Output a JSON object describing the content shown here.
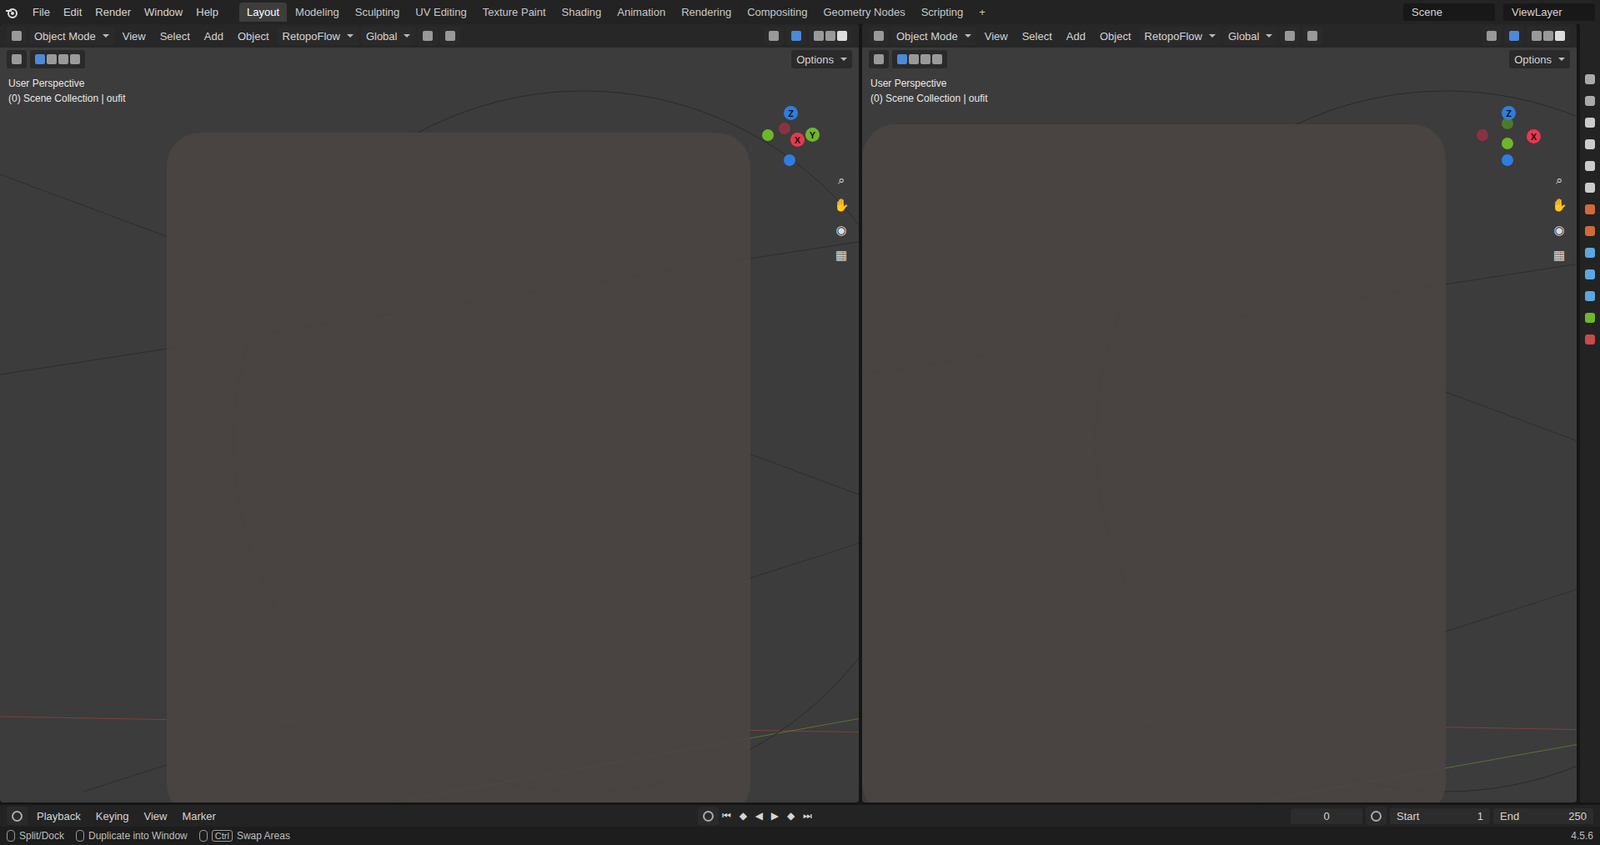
{
  "topbar": {
    "menus": [
      "File",
      "Edit",
      "Render",
      "Window",
      "Help"
    ],
    "workspaces": [
      {
        "label": "Layout",
        "selected": true
      },
      {
        "label": "Modeling",
        "selected": false
      },
      {
        "label": "Sculpting",
        "selected": false
      },
      {
        "label": "UV Editing",
        "selected": false
      },
      {
        "label": "Texture Paint",
        "selected": false
      },
      {
        "label": "Shading",
        "selected": false
      },
      {
        "label": "Animation",
        "selected": false
      },
      {
        "label": "Rendering",
        "selected": false
      },
      {
        "label": "Compositing",
        "selected": false
      },
      {
        "label": "Geometry Nodes",
        "selected": false
      },
      {
        "label": "Scripting",
        "selected": false
      }
    ],
    "add_tab": "+",
    "scene": "Scene",
    "view_layer": "ViewLayer"
  },
  "viewports": [
    {
      "mode": "Object Mode",
      "menus": [
        "View",
        "Select",
        "Add",
        "Object"
      ],
      "addon": "RetopoFlow",
      "orientation": "Global",
      "options": "Options",
      "view_name": "User Perspective",
      "collection": "(0) Scene Collection | oufit",
      "gizmo": [
        {
          "label": "Z",
          "color": "#2f7de1"
        },
        {
          "label": "Y",
          "color": "#6fb62a"
        },
        {
          "label": "X",
          "color": "#e8384f"
        }
      ]
    },
    {
      "mode": "Object Mode",
      "menus": [
        "View",
        "Select",
        "Add",
        "Object"
      ],
      "addon": "RetopoFlow",
      "orientation": "Global",
      "options": "Options",
      "view_name": "User Perspective",
      "collection": "(0) Scene Collection | oufit",
      "gizmo": [
        {
          "label": "Z",
          "color": "#2f7de1"
        },
        {
          "label": "X",
          "color": "#e8384f"
        }
      ]
    }
  ],
  "timeline": {
    "menus": [
      "Playback",
      "Keying",
      "View",
      "Marker"
    ],
    "current_frame": "0",
    "start_label": "Start",
    "start": "1",
    "end_label": "End",
    "end": "250"
  },
  "status_bar": {
    "hints": [
      {
        "key": "",
        "label": "Split/Dock"
      },
      {
        "key": "",
        "label": "Duplicate into Window"
      },
      {
        "key": "Ctrl",
        "label": "Swap Areas"
      }
    ],
    "version": "4.5.6"
  }
}
